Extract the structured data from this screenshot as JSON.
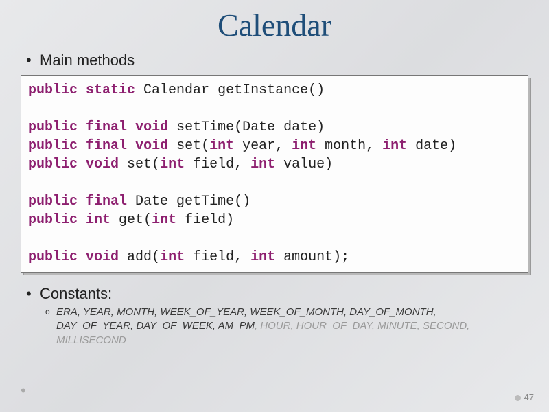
{
  "title": "Calendar",
  "bullet1": "Main methods",
  "code": {
    "tokens": [
      [
        {
          "k": "kw",
          "t": "public"
        },
        {
          "k": "p",
          "t": " "
        },
        {
          "k": "kw",
          "t": "static"
        },
        {
          "k": "p",
          "t": " Calendar getInstance()"
        }
      ],
      [
        {
          "k": "p",
          "t": ""
        }
      ],
      [
        {
          "k": "kw",
          "t": "public"
        },
        {
          "k": "p",
          "t": " "
        },
        {
          "k": "kw",
          "t": "final"
        },
        {
          "k": "p",
          "t": " "
        },
        {
          "k": "kw",
          "t": "void"
        },
        {
          "k": "p",
          "t": " setTime(Date date)"
        }
      ],
      [
        {
          "k": "kw",
          "t": "public"
        },
        {
          "k": "p",
          "t": " "
        },
        {
          "k": "kw",
          "t": "final"
        },
        {
          "k": "p",
          "t": " "
        },
        {
          "k": "kw",
          "t": "void"
        },
        {
          "k": "p",
          "t": " set("
        },
        {
          "k": "kw",
          "t": "int"
        },
        {
          "k": "p",
          "t": " year, "
        },
        {
          "k": "kw",
          "t": "int"
        },
        {
          "k": "p",
          "t": " month, "
        },
        {
          "k": "kw",
          "t": "int"
        },
        {
          "k": "p",
          "t": " date)"
        }
      ],
      [
        {
          "k": "kw",
          "t": "public"
        },
        {
          "k": "p",
          "t": " "
        },
        {
          "k": "kw",
          "t": "void"
        },
        {
          "k": "p",
          "t": " set("
        },
        {
          "k": "kw",
          "t": "int"
        },
        {
          "k": "p",
          "t": " field, "
        },
        {
          "k": "kw",
          "t": "int"
        },
        {
          "k": "p",
          "t": " value)"
        }
      ],
      [
        {
          "k": "p",
          "t": ""
        }
      ],
      [
        {
          "k": "kw",
          "t": "public"
        },
        {
          "k": "p",
          "t": " "
        },
        {
          "k": "kw",
          "t": "final"
        },
        {
          "k": "p",
          "t": " Date getTime()"
        }
      ],
      [
        {
          "k": "kw",
          "t": "public"
        },
        {
          "k": "p",
          "t": " "
        },
        {
          "k": "kw",
          "t": "int"
        },
        {
          "k": "p",
          "t": " get("
        },
        {
          "k": "kw",
          "t": "int"
        },
        {
          "k": "p",
          "t": " field)"
        }
      ],
      [
        {
          "k": "p",
          "t": ""
        }
      ],
      [
        {
          "k": "kw",
          "t": "public"
        },
        {
          "k": "p",
          "t": " "
        },
        {
          "k": "kw",
          "t": "void"
        },
        {
          "k": "p",
          "t": " add("
        },
        {
          "k": "kw",
          "t": "int"
        },
        {
          "k": "p",
          "t": " field, "
        },
        {
          "k": "kw",
          "t": "int"
        },
        {
          "k": "p",
          "t": " amount);"
        }
      ]
    ]
  },
  "bullet2": "Constants:",
  "constants": [
    {
      "c": "dark",
      "t": "ERA, YEAR, MONTH, WEEK_OF_YEAR, WEEK_OF_MONTH, DAY_OF_MONTH, DAY_OF_YEAR, DAY_OF_WEEK, AM_PM"
    },
    {
      "c": "light",
      "t": ", HOUR, HOUR_OF_DAY, MINUTE, SECOND, MILLISECOND"
    }
  ],
  "page": "47"
}
